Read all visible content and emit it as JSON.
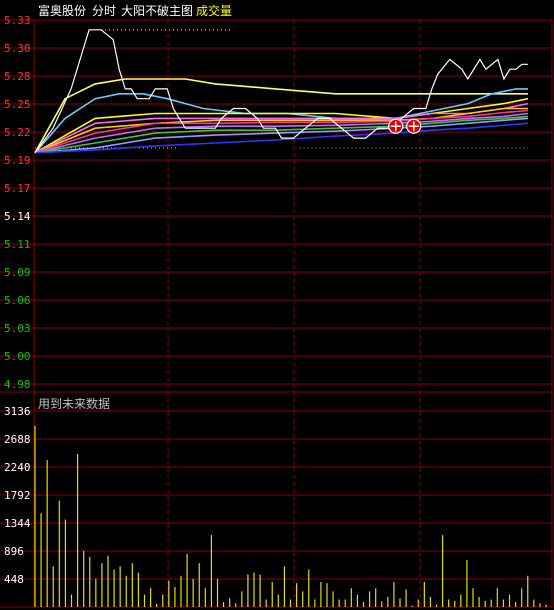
{
  "header": {
    "stock_name": "富奥股份",
    "period": "分时",
    "indicator": "大阳不破主图",
    "volume_label": "成交量"
  },
  "note": "用到未来数据",
  "colors": {
    "background": "#000000",
    "grid": "#8b0000",
    "price_up": "#ff3232",
    "price_down": "#00c800",
    "price_ref": "#ffffff",
    "header_text": "#ffffff",
    "volume_label": "#ffff00",
    "note": "#c0c0c0",
    "volume_bar": "#e0e000"
  },
  "chart_data": [
    {
      "type": "line",
      "title": "",
      "ylim": [
        4.96,
        5.33
      ],
      "y_ticks": [
        "5.33",
        "5.30",
        "5.28",
        "5.25",
        "5.22",
        "5.19",
        "5.17",
        "5.14",
        "5.11",
        "5.09",
        "5.06",
        "5.03",
        "5.00",
        "4.98"
      ],
      "y_tick_values": [
        5.33,
        5.3,
        5.28,
        5.25,
        5.22,
        5.19,
        5.17,
        5.14,
        5.11,
        5.09,
        5.06,
        5.03,
        5.0,
        4.98
      ],
      "reference_price": "5.14",
      "x_range": [
        0,
        85
      ],
      "grid": true,
      "series": [
        {
          "color": "#ffffff",
          "x": [
            0,
            3,
            6,
            8,
            9,
            11,
            13,
            14,
            15,
            16,
            17,
            19,
            20,
            22,
            23,
            24,
            25,
            27,
            28,
            30,
            31,
            33,
            35,
            37,
            38,
            40,
            41,
            43,
            45,
            47,
            49,
            51,
            53,
            55,
            57,
            59,
            61,
            63,
            64,
            65,
            66,
            67,
            69,
            71,
            72,
            74,
            75,
            77,
            78,
            79,
            80,
            81,
            82
          ],
          "y": [
            5.195,
            5.22,
            5.26,
            5.3,
            5.32,
            5.32,
            5.31,
            5.28,
            5.26,
            5.26,
            5.25,
            5.25,
            5.26,
            5.26,
            5.24,
            5.23,
            5.22,
            5.22,
            5.22,
            5.22,
            5.23,
            5.24,
            5.24,
            5.23,
            5.22,
            5.22,
            5.21,
            5.21,
            5.22,
            5.23,
            5.23,
            5.22,
            5.21,
            5.21,
            5.22,
            5.22,
            5.23,
            5.24,
            5.24,
            5.24,
            5.26,
            5.275,
            5.29,
            5.28,
            5.27,
            5.29,
            5.28,
            5.29,
            5.27,
            5.28,
            5.28,
            5.285,
            5.285
          ]
        },
        {
          "color": "#ffff66",
          "x": [
            0,
            5,
            10,
            15,
            20,
            25,
            30,
            40,
            50,
            60,
            70,
            80,
            82
          ],
          "y": [
            5.195,
            5.25,
            5.265,
            5.27,
            5.27,
            5.27,
            5.265,
            5.26,
            5.255,
            5.255,
            5.255,
            5.255,
            5.255
          ]
        },
        {
          "color": "#66ccff",
          "x": [
            0,
            5,
            10,
            14,
            18,
            22,
            28,
            35,
            42,
            50,
            56,
            60,
            64,
            68,
            72,
            76,
            80,
            82
          ],
          "y": [
            5.195,
            5.23,
            5.25,
            5.255,
            5.255,
            5.25,
            5.24,
            5.235,
            5.235,
            5.23,
            5.23,
            5.23,
            5.235,
            5.24,
            5.245,
            5.255,
            5.26,
            5.26
          ]
        },
        {
          "color": "#ffff00",
          "x": [
            0,
            10,
            20,
            30,
            40,
            50,
            60,
            66,
            72,
            78,
            82
          ],
          "y": [
            5.195,
            5.23,
            5.235,
            5.235,
            5.235,
            5.235,
            5.23,
            5.235,
            5.24,
            5.245,
            5.25
          ]
        },
        {
          "color": "#ff66ff",
          "x": [
            0,
            10,
            20,
            30,
            40,
            50,
            60,
            66,
            72,
            78,
            82
          ],
          "y": [
            5.195,
            5.225,
            5.23,
            5.23,
            5.23,
            5.23,
            5.23,
            5.235,
            5.235,
            5.24,
            5.245
          ]
        },
        {
          "color": "#ffcc00",
          "x": [
            0,
            10,
            20,
            30,
            40,
            50,
            60,
            66,
            72,
            78,
            82
          ],
          "y": [
            5.195,
            5.22,
            5.225,
            5.228,
            5.228,
            5.228,
            5.228,
            5.23,
            5.235,
            5.24,
            5.24
          ]
        },
        {
          "color": "#ff3399",
          "x": [
            0,
            10,
            20,
            30,
            40,
            50,
            60,
            66,
            72,
            78,
            82
          ],
          "y": [
            5.195,
            5.215,
            5.225,
            5.225,
            5.226,
            5.226,
            5.227,
            5.23,
            5.232,
            5.236,
            5.238
          ]
        },
        {
          "color": "#cc66ff",
          "x": [
            0,
            10,
            20,
            30,
            40,
            50,
            60,
            66,
            72,
            78,
            82
          ],
          "y": [
            5.195,
            5.21,
            5.22,
            5.222,
            5.222,
            5.223,
            5.225,
            5.227,
            5.23,
            5.232,
            5.235
          ]
        },
        {
          "color": "#33cc33",
          "x": [
            0,
            10,
            20,
            30,
            40,
            50,
            60,
            66,
            72,
            78,
            82
          ],
          "y": [
            5.195,
            5.205,
            5.215,
            5.218,
            5.218,
            5.22,
            5.222,
            5.225,
            5.228,
            5.23,
            5.232
          ]
        },
        {
          "color": "#9999ff",
          "x": [
            0,
            10,
            20,
            30,
            40,
            50,
            60,
            66,
            72,
            78,
            82
          ],
          "y": [
            5.195,
            5.2,
            5.21,
            5.213,
            5.215,
            5.217,
            5.22,
            5.222,
            5.225,
            5.228,
            5.23
          ]
        },
        {
          "color": "#3333ff",
          "x": [
            0,
            10,
            20,
            30,
            40,
            50,
            60,
            66,
            72,
            78,
            82
          ],
          "y": [
            5.195,
            5.198,
            5.202,
            5.205,
            5.208,
            5.212,
            5.215,
            5.218,
            5.22,
            5.223,
            5.225
          ]
        }
      ],
      "dotted_levels": [
        {
          "y": 5.32,
          "x": [
            11,
            33
          ],
          "color": "#ffff66"
        },
        {
          "y": 5.2,
          "x": [
            0,
            24
          ],
          "color": "#66ff66"
        },
        {
          "y": 5.2,
          "x": [
            44,
            82
          ],
          "color": "#66ff66"
        }
      ],
      "markers": [
        {
          "x": 60,
          "y": 5.222,
          "color": "#e00000"
        },
        {
          "x": 63,
          "y": 5.222,
          "color": "#e00000"
        }
      ]
    },
    {
      "type": "bar",
      "title": "成交量",
      "ylim": [
        0,
        3136
      ],
      "y_ticks": [
        "3136",
        "2688",
        "2240",
        "1792",
        "1344",
        "896",
        "448"
      ],
      "y_tick_values": [
        3136,
        2688,
        2240,
        1792,
        1344,
        896,
        448
      ],
      "x_range": [
        0,
        85
      ],
      "values": [
        2900,
        1500,
        2350,
        650,
        1700,
        1400,
        200,
        2450,
        900,
        800,
        450,
        700,
        820,
        600,
        650,
        500,
        700,
        550,
        200,
        300,
        50,
        200,
        420,
        320,
        500,
        850,
        450,
        700,
        300,
        1150,
        450,
        80,
        140,
        60,
        250,
        520,
        550,
        520,
        120,
        400,
        200,
        650,
        120,
        380,
        250,
        600,
        120,
        400,
        380,
        250,
        120,
        120,
        300,
        200,
        80,
        250,
        300,
        90,
        160,
        400,
        140,
        280,
        20,
        120,
        400,
        160,
        40,
        1150,
        120,
        100,
        200,
        750,
        300,
        160,
        100,
        120,
        300,
        120,
        200,
        80,
        300,
        500,
        120,
        60,
        40
      ],
      "grid": true
    }
  ]
}
